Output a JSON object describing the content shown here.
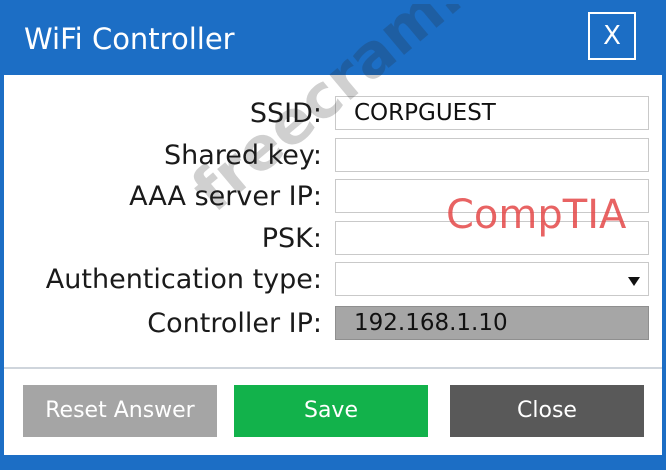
{
  "window": {
    "title": "WiFi Controller",
    "close_glyph": "X"
  },
  "form": {
    "ssid": {
      "label": "SSID:",
      "value": "CORPGUEST"
    },
    "shared_key": {
      "label": "Shared key:",
      "value": ""
    },
    "aaa_server_ip": {
      "label": "AAA server IP:",
      "value": ""
    },
    "psk": {
      "label": "PSK:",
      "value": ""
    },
    "authentication_type": {
      "label": "Authentication type:",
      "value": ""
    },
    "controller_ip": {
      "label": "Controller IP:",
      "value": "192.168.1.10"
    }
  },
  "buttons": {
    "reset": "Reset Answer",
    "save": "Save",
    "close": "Close"
  },
  "watermark": {
    "site": "freecram.net",
    "brand": "CompTIA"
  },
  "colors": {
    "title_bar": "#1c6ec5",
    "save_button": "#12b24b",
    "reset_button": "#a5a5a5",
    "close_button": "#595959",
    "readonly_field": "#a6a6a6",
    "brand_watermark": "#e44848"
  }
}
